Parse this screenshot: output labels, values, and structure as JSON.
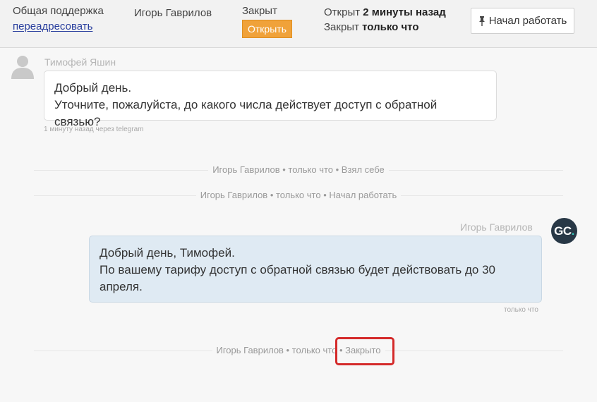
{
  "header": {
    "queue": "Общая поддержка",
    "forward_link": "переадресовать",
    "assignee": "Игорь Гаврилов",
    "status": "Закрыт",
    "open_button": "Открыть",
    "opened_prefix": "Открыт",
    "opened_value": "2 минуты назад",
    "closed_prefix": "Закрыт",
    "closed_value": "только что",
    "start_button": "Начал работать"
  },
  "messages": [
    {
      "author": "Тимофей Яшин",
      "line1": "Добрый день.",
      "line2": "Уточните, пожалуйста, до какого числа действует доступ с обратной связью?",
      "meta": "1 минуту назад через telegram"
    },
    {
      "author": "Игорь Гаврилов",
      "avatar_text": "GC",
      "avatar_dot": ".",
      "line1": "Добрый день, Тимофей.",
      "line2": "По вашему тарифу доступ с обратной связью будет действовать до 30",
      "line3": "апреля.",
      "meta": "только что"
    }
  ],
  "events": [
    {
      "text": "Игорь Гаврилов • только что • Взял себе"
    },
    {
      "text": "Игорь Гаврилов • только что • Начал работать"
    },
    {
      "prefix": "Игорь Гаврилов • только что",
      "suffix": "• Закрыто"
    }
  ],
  "colors": {
    "accent_orange": "#f0a23a",
    "highlight_red": "#d42a2a",
    "agent_bubble": "#dfeaf3",
    "avatar_dark": "#283846",
    "avatar_dot": "#35c4b7"
  },
  "icons": {
    "start_button": "pushpin-icon",
    "client_avatar": "user-silhouette-icon"
  }
}
